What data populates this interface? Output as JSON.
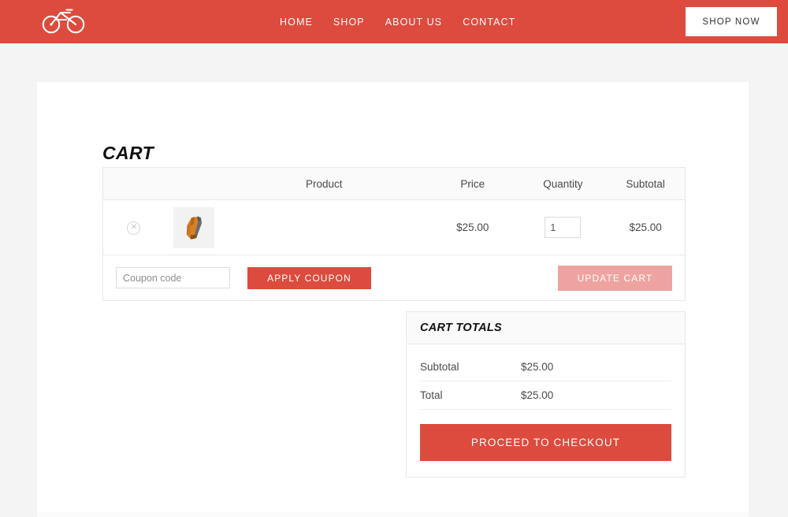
{
  "header": {
    "logo_icon": "bicycle-icon",
    "brand_color": "#DD4B3E",
    "nav": [
      {
        "label": "HOME"
      },
      {
        "label": "SHOP"
      },
      {
        "label": "ABOUT US"
      },
      {
        "label": "CONTACT"
      }
    ],
    "cta_label": "SHOP NOW"
  },
  "page": {
    "title": "CART",
    "background_color": "#f4f4f4",
    "card_color": "#ffffff"
  },
  "cart_table": {
    "columns": [
      {
        "key": "remove",
        "label": ""
      },
      {
        "key": "thumb",
        "label": ""
      },
      {
        "key": "product",
        "label": "Product"
      },
      {
        "key": "price",
        "label": "Price"
      },
      {
        "key": "quantity",
        "label": "Quantity"
      },
      {
        "key": "subtotal",
        "label": "Subtotal"
      }
    ],
    "rows": [
      {
        "remove_icon": "remove-circle-x-icon",
        "thumb_alt": "cycling-glove",
        "product": "",
        "price": "$25.00",
        "quantity": "1",
        "subtotal": "$25.00"
      }
    ]
  },
  "coupon": {
    "placeholder": "Coupon code",
    "value": "",
    "apply_label": "APPLY COUPON",
    "update_label": "UPDATE CART",
    "apply_color": "#DD4B3E",
    "update_color": "#EFA3A0"
  },
  "cart_totals": {
    "heading": "CART TOTALS",
    "lines": [
      {
        "label": "Subtotal",
        "value": "$25.00"
      },
      {
        "label": "Total",
        "value": "$25.00"
      }
    ],
    "checkout_label": "PROCEED TO CHECKOUT",
    "checkout_color": "#DD4B3E"
  }
}
